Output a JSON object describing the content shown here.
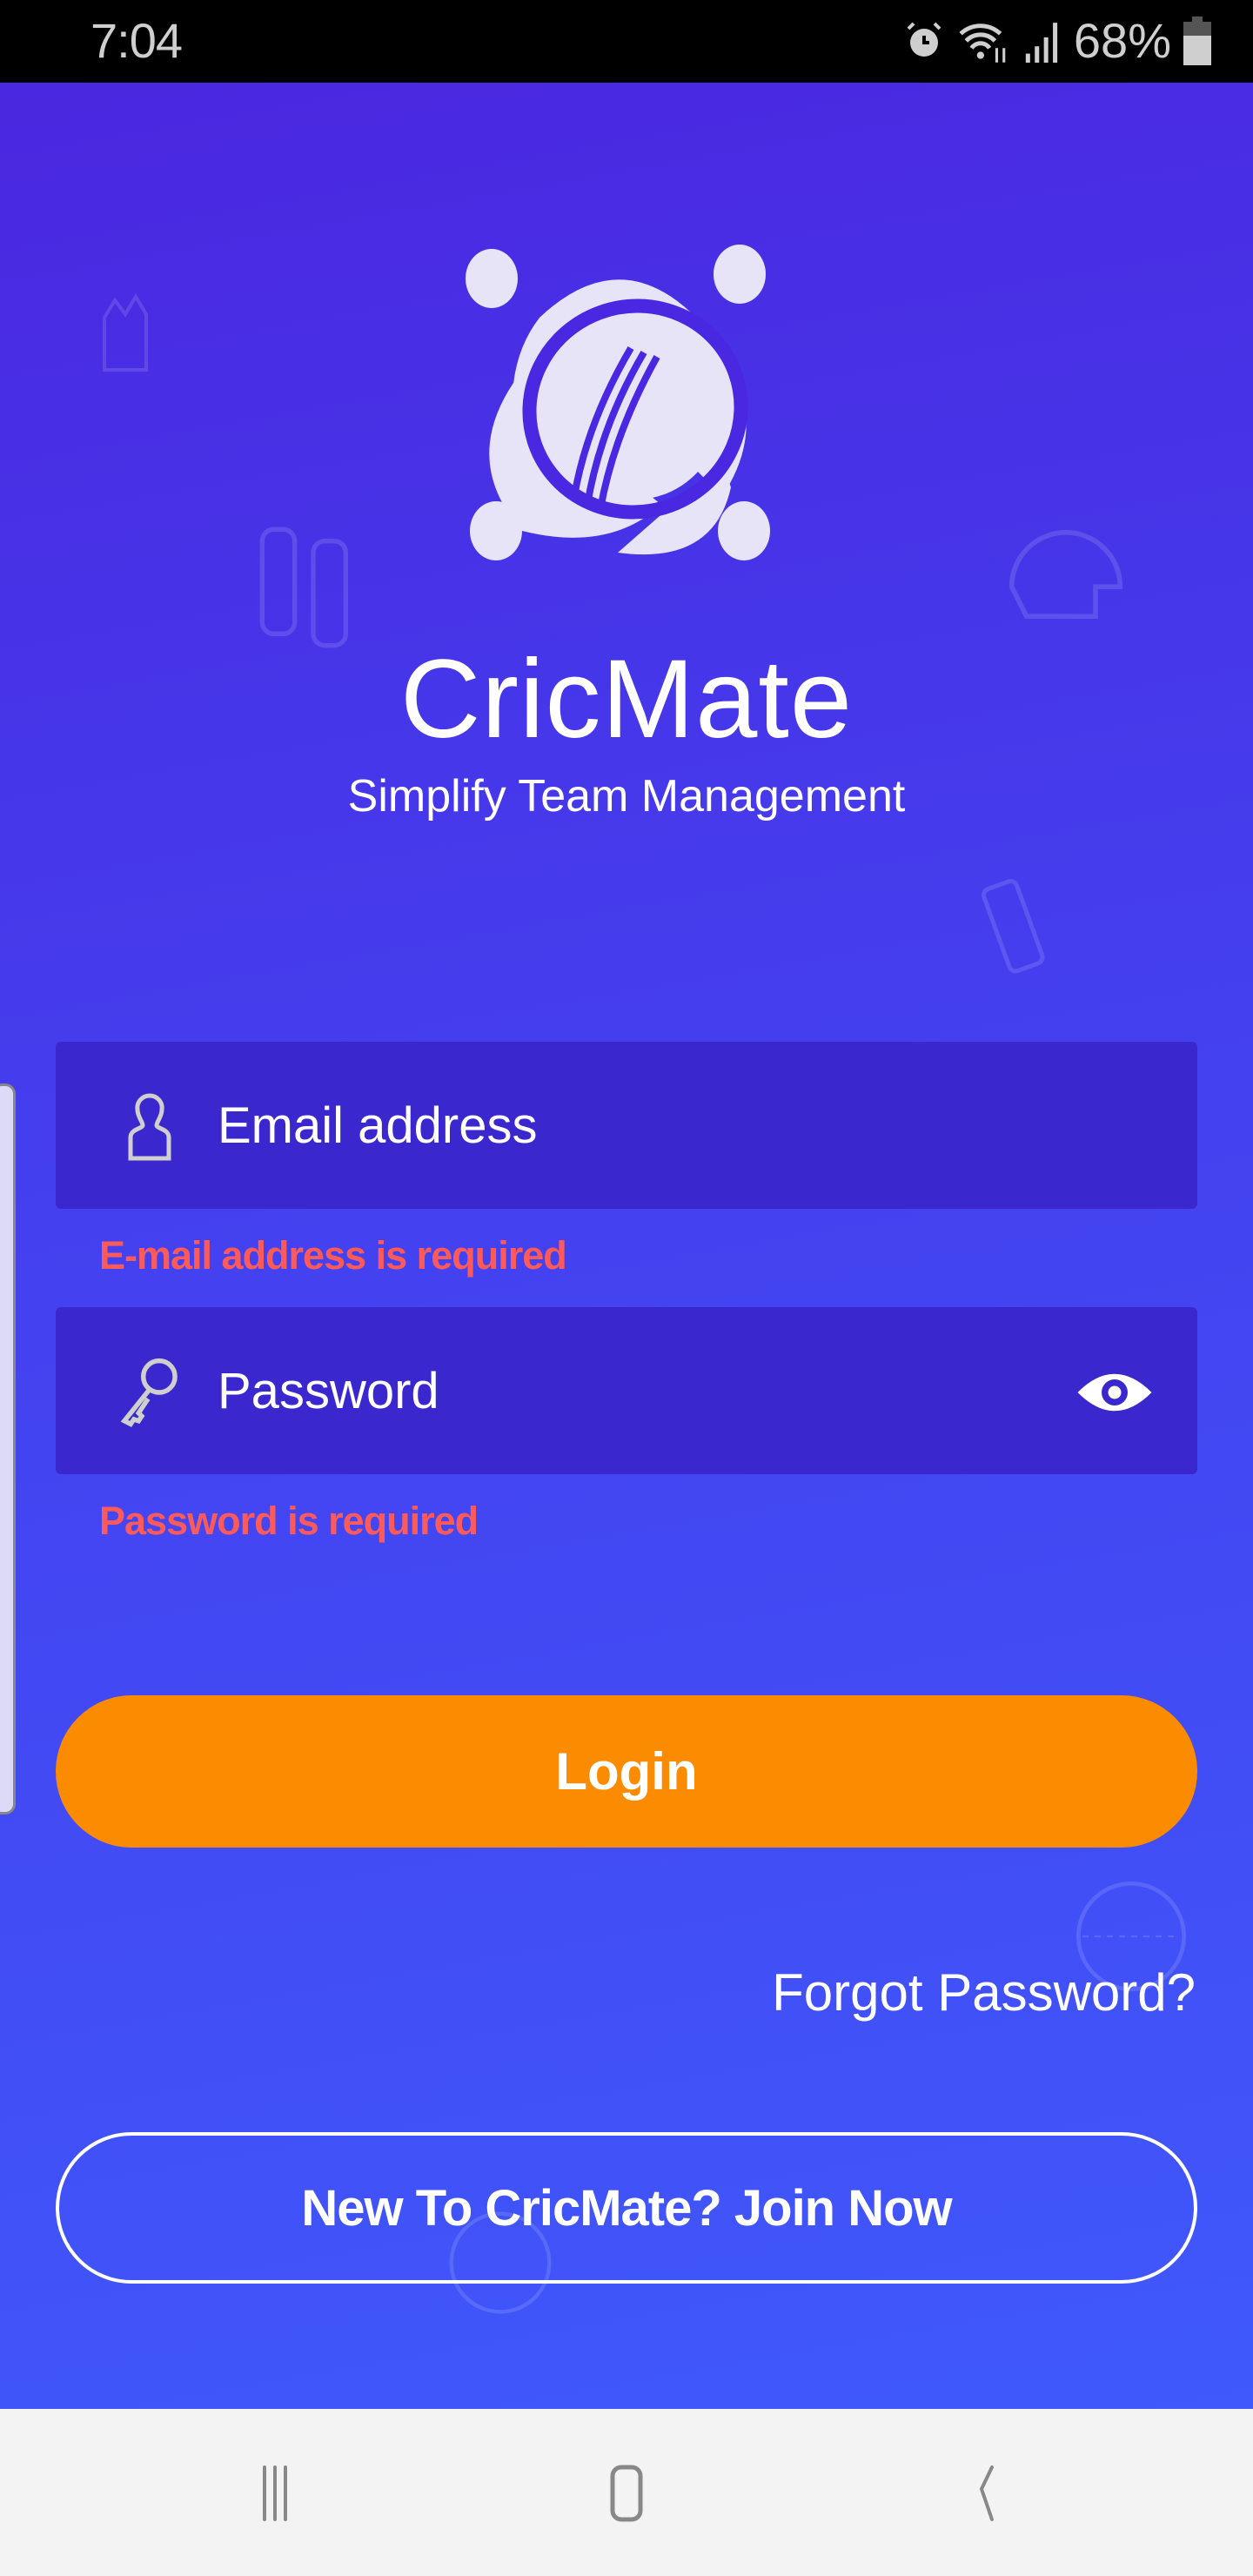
{
  "status_bar": {
    "time": "7:04",
    "battery": "68%",
    "icons": [
      "alarm-icon",
      "wifi-icon",
      "signal-icon",
      "battery-icon"
    ]
  },
  "app": {
    "name": "CricMate",
    "tagline": "Simplify Team Management"
  },
  "form": {
    "email": {
      "placeholder": "Email address",
      "value": "",
      "error": "E-mail address is required",
      "icon": "user-icon"
    },
    "password": {
      "placeholder": "Password",
      "value": "",
      "error": "Password is required",
      "icon": "key-icon",
      "toggle_icon": "eye-icon"
    },
    "login_label": "Login",
    "forgot_label": "Forgot Password?",
    "join_label": "New To CricMate? Join Now"
  },
  "colors": {
    "primary": "#4a27e0",
    "field": "#3a28ce",
    "accent": "#fb8b00",
    "error": "#ff5a5a"
  },
  "nav_bar": {
    "icons": [
      "recent-apps-icon",
      "home-icon",
      "back-icon"
    ]
  }
}
